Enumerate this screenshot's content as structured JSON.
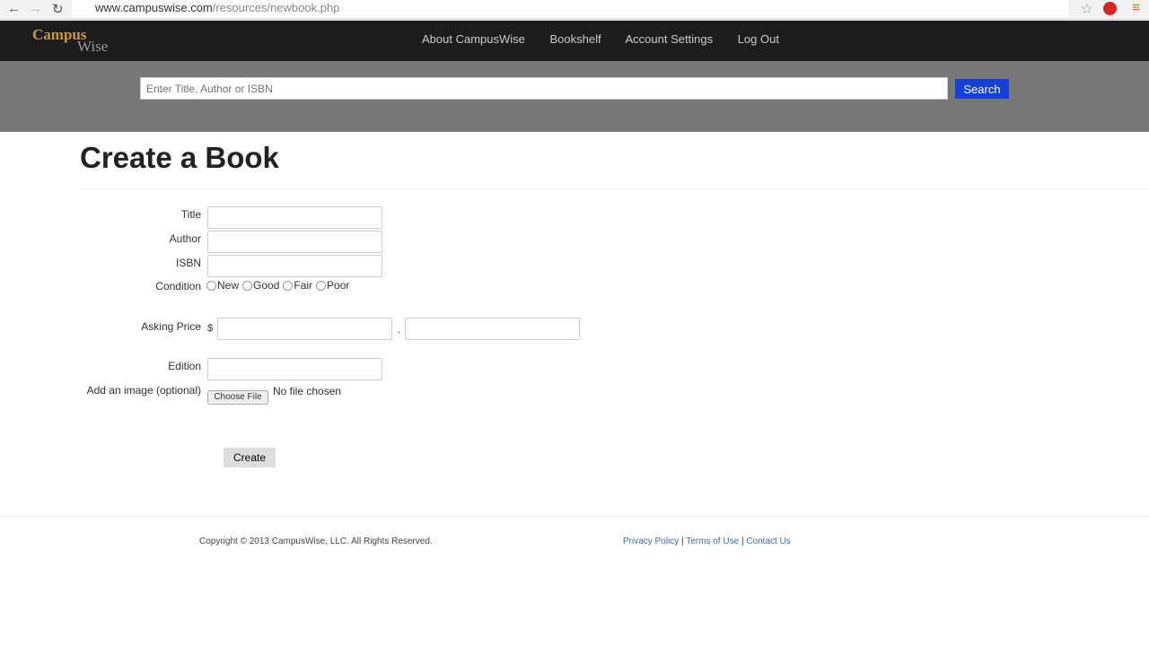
{
  "browser": {
    "url_host": "www.campuswise.com",
    "url_path": "/resources/newbook.php"
  },
  "header": {
    "logo_top": "Campus",
    "logo_bottom": "Wise",
    "nav": [
      "About CampusWise",
      "Bookshelf",
      "Account Settings",
      "Log Out"
    ]
  },
  "search": {
    "placeholder": "Enter Title, Author or ISBN",
    "button": "Search"
  },
  "page": {
    "title": "Create a Book"
  },
  "form": {
    "title": "Title",
    "author": "Author",
    "isbn": "ISBN",
    "condition": "Condition",
    "conditions": [
      "New",
      "Good",
      "Fair",
      "Poor"
    ],
    "asking_price": "Asking Price",
    "currency": "$",
    "decimal": ".",
    "edition": "Edition",
    "image": "Add an image (optional)",
    "choose_file": "Choose File",
    "no_file": "No file chosen",
    "submit": "Create"
  },
  "footer": {
    "copyright": "Copyright © 2013 CampusWise, LLC. All Rights Reserved.",
    "links": [
      "Privacy Policy",
      "Terms of Use",
      "Contact Us"
    ],
    "sep": "|"
  }
}
